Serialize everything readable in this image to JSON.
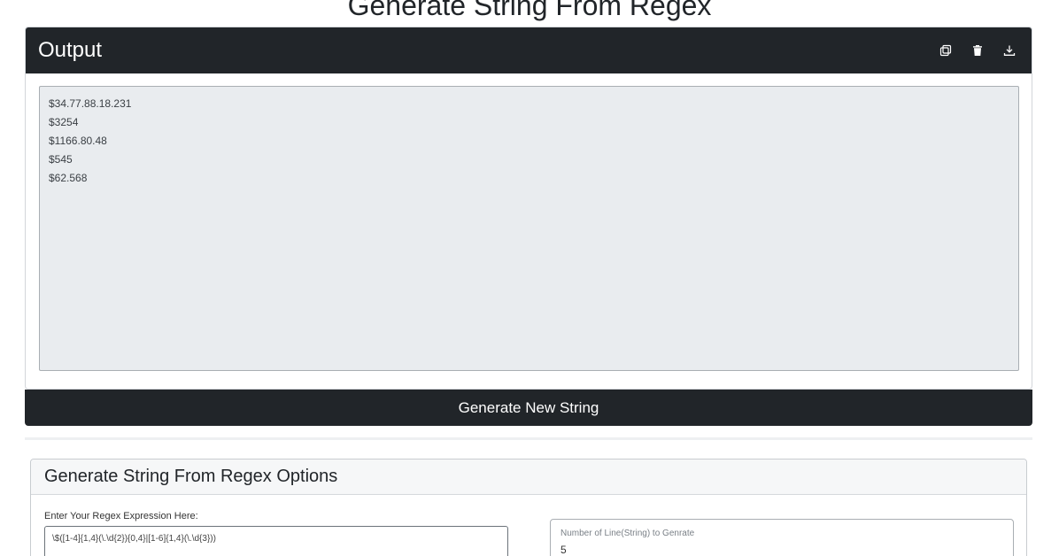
{
  "page": {
    "title": "Generate String From Regex"
  },
  "output": {
    "title": "Output",
    "text": "$34.77.88.18.231\n$3254\n$1166.80.48\n$545\n$62.568",
    "actions": {
      "copy_icon": "copy-icon",
      "delete_icon": "trash-icon",
      "download_icon": "download-icon"
    }
  },
  "generate_button": {
    "label": "Generate New String"
  },
  "options": {
    "title": "Generate String From Regex Options",
    "regex_label": "Enter Your Regex Expression Here:",
    "regex_value": "\\$([1-4]{1,4}(\\.\\d{2}){0,4}|[1-6]{1,4}(\\.\\d{3}))",
    "count_label": "Number of Line(String) to Genrate",
    "count_value": "5"
  },
  "colors": {
    "dark": "#212529",
    "output_bg": "#e9ecef"
  }
}
